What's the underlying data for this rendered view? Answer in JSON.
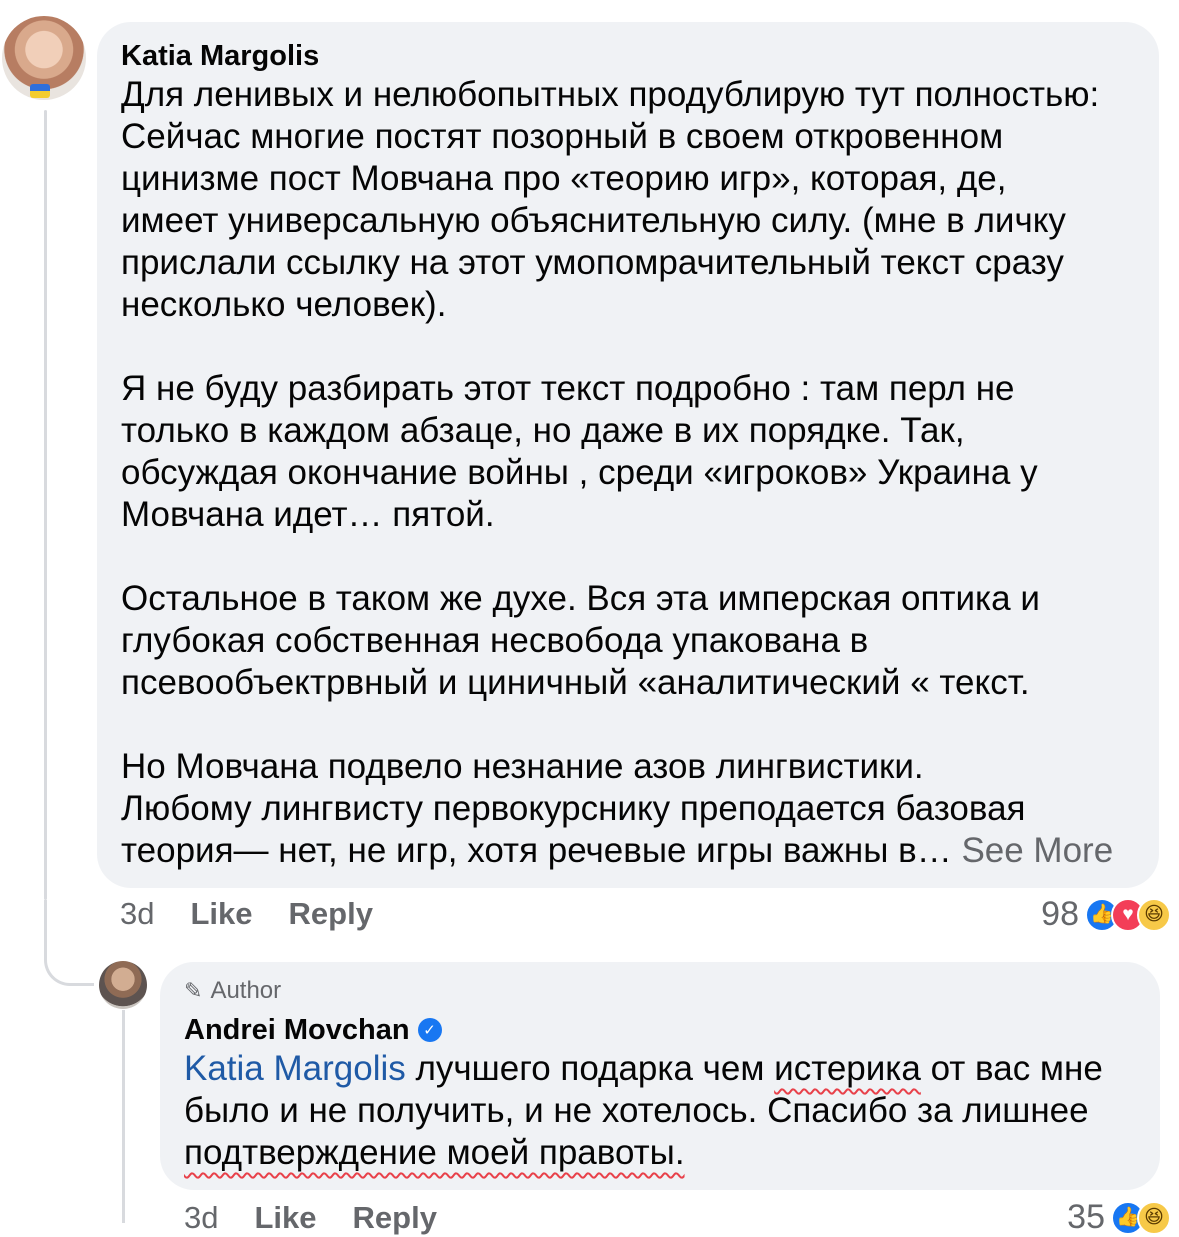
{
  "comment1": {
    "author": "Katia Margolis",
    "paragraphs": [
      "Для ленивых и нелюбопытных продублирую тут полностью:",
      "Сейчас многие постят позорный в своем откровенном",
      "цинизме пост Мовчана про «теорию игр», которая, де,",
      "имеет универсальную объяснительную силу. (мне в личку",
      "прислали ссылку на этот умопомрачительный текст сразу",
      "несколько человек)."
    ],
    "paragraph2": [
      "Я не буду разбирать этот текст подробно : там перл не",
      "только в каждом абзаце, но даже в их порядке. Так,",
      "обсуждая окончание войны , среди «игроков» Украина у",
      "Мовчана идет… пятой."
    ],
    "paragraph3": [
      "Остальное в таком же духе. Вся эта имперская оптика и",
      "глубокая собственная несвобода упакована в",
      "псевообъектрвный и циничный «аналитический « текст."
    ],
    "paragraph4": [
      "Но Мовчана подвело незнание азов лингвистики.",
      "Любому лингвисту первокурснику преподается базовая",
      "теория— нет, не игр, хотя речевые игры важны в… "
    ],
    "see_more": "See More",
    "time": "3d",
    "like": "Like",
    "reply": "Reply",
    "reaction_count": "98"
  },
  "comment2": {
    "badge": "Author",
    "author": "Andrei Movchan",
    "mention": "Katia Margolis",
    "line1_a": " лучшего подарка чем ",
    "line1_b": "истерика",
    "line1_c": " от вас мне",
    "line2": "было и не получить, и не хотелось. Спасибо за лишнее",
    "line3": "подтверждение моей правоты.",
    "time": "3d",
    "like": "Like",
    "reply": "Reply",
    "reaction_count": "35"
  },
  "icons": {
    "like": "thumbs-up",
    "love": "heart",
    "haha": "laughing-face",
    "badge": "pen",
    "verified": "check"
  },
  "colors": {
    "bubble": "#f0f2f5",
    "mention": "#1f5aa6",
    "meta": "#65676b",
    "underline": "#e8414a"
  }
}
